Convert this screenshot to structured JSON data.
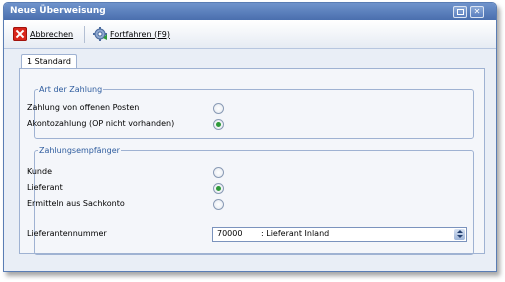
{
  "window": {
    "title": "Neue Überweisung"
  },
  "toolbar": {
    "cancel_label": "Abbrechen",
    "continue_label": "Fortfahren (F9)"
  },
  "tab": {
    "label": "1 Standard"
  },
  "section_payment_type": {
    "legend": "Art der Zahlung",
    "options": [
      {
        "label": "Zahlung von offenen Posten",
        "selected": false
      },
      {
        "label": "Akontozahlung (OP nicht vorhanden)",
        "selected": true
      }
    ]
  },
  "section_recipient": {
    "legend": "Zahlungsempfänger",
    "options": [
      {
        "label": "Kunde",
        "selected": false
      },
      {
        "label": "Lieferant",
        "selected": true
      },
      {
        "label": "Ermitteln aus Sachkonto",
        "selected": false
      }
    ],
    "supplier_number_label": "Lieferantennummer",
    "supplier_number_value": "70000",
    "supplier_number_desc": ": Lieferant Inland"
  },
  "colors": {
    "accent": "#2e5c9e",
    "radio_selected": "#2f9a3a",
    "cancel_icon": "#d9261c"
  },
  "icons": [
    "close-icon",
    "restore-icon",
    "cancel-icon",
    "gear-icon",
    "spin-arrows-icon"
  ]
}
